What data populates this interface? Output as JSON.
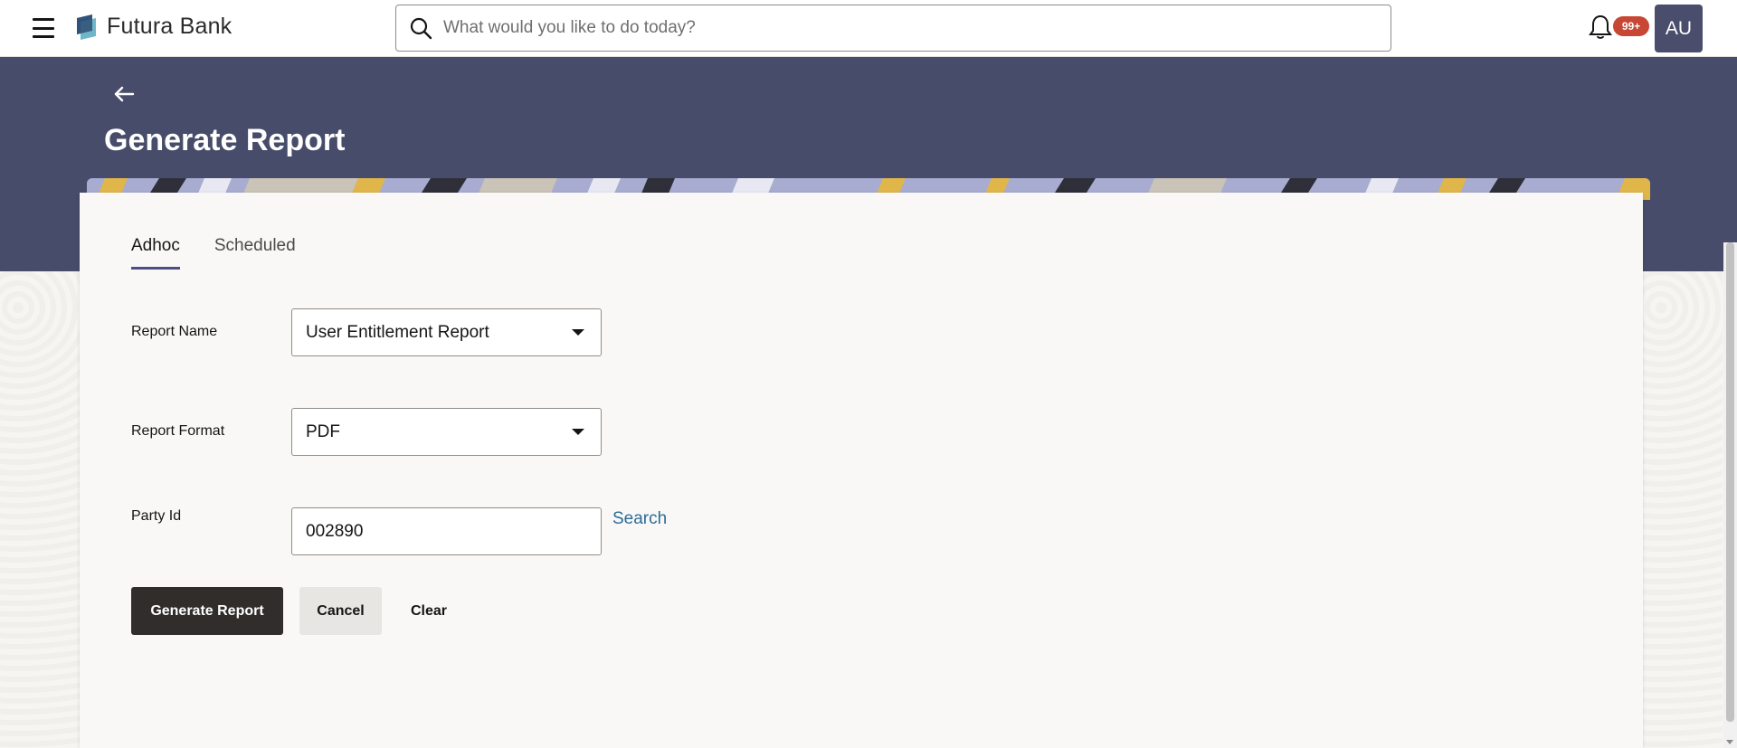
{
  "header": {
    "brand_name": "Futura Bank",
    "search_placeholder": "What would you like to do today?",
    "notification_count": "99+",
    "avatar_initials": "AU"
  },
  "page": {
    "title": "Generate Report"
  },
  "tabs": [
    {
      "label": "Adhoc",
      "active": true
    },
    {
      "label": "Scheduled",
      "active": false
    }
  ],
  "form": {
    "report_name": {
      "label": "Report Name",
      "value": "User Entitlement Report"
    },
    "report_format": {
      "label": "Report Format",
      "value": "PDF"
    },
    "party_id": {
      "label": "Party Id",
      "value": "002890",
      "search_label": "Search"
    }
  },
  "buttons": {
    "generate": "Generate Report",
    "cancel": "Cancel",
    "clear": "Clear"
  },
  "colors": {
    "banner": "#474c6a",
    "primary_button": "#312d2a",
    "link": "#2c6d96",
    "badge": "#c74634",
    "avatar": "#4a4d6b"
  }
}
